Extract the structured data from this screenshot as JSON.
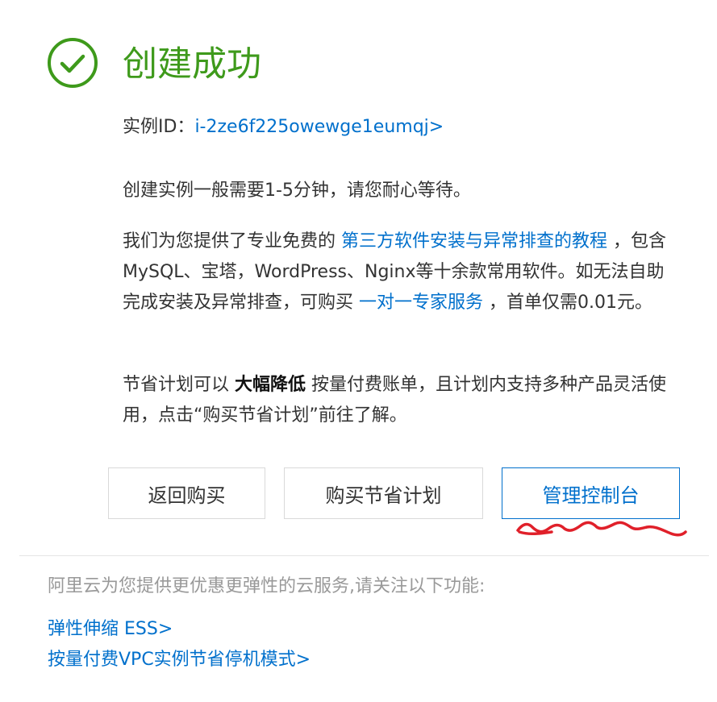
{
  "header": {
    "icon": "check-circle-icon",
    "title": "创建成功",
    "accent_color": "#3e9a1b"
  },
  "instance": {
    "label": "实例ID：",
    "id_link": "i-2ze6f225owewge1eumqj>"
  },
  "info": {
    "wait_text": "创建实例一般需要1-5分钟，请您耐心等待。",
    "tutorial_prefix": "我们为您提供了专业免费的 ",
    "tutorial_link": "第三方软件安装与异常排查的教程",
    "tutorial_middle": " ，包含MySQL、宝塔，WordPress、Nginx等十余款常用软件。如无法自助完成安装及异常排查，可购买 ",
    "expert_link": "一对一专家服务",
    "tutorial_suffix": " ，首单仅需0.01元。",
    "plan_prefix": "节省计划可以 ",
    "plan_bold": "大幅降低",
    "plan_suffix": " 按量付费账单，且计划内支持多种产品灵活使用，点击“购买节省计划”前往了解。"
  },
  "buttons": {
    "back": "返回购买",
    "buy_plan": "购买节省计划",
    "console": "管理控制台"
  },
  "annotation": {
    "color": "#e0202a"
  },
  "footer": {
    "note": "阿里云为您提供更优惠更弹性的云服务,请关注以下功能:",
    "links": [
      "弹性伸缩 ESS>",
      "按量付费VPC实例节省停机模式>"
    ]
  },
  "link_color": "#0070cc"
}
